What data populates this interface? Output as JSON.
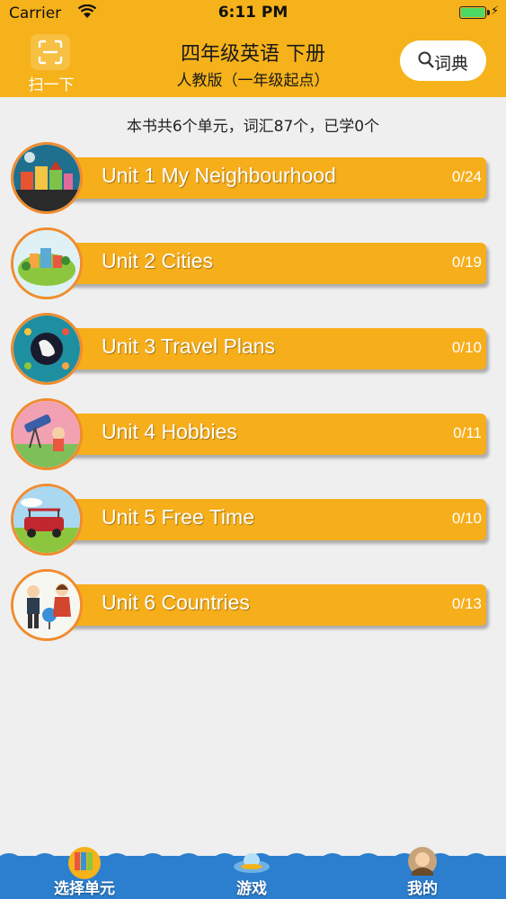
{
  "status_bar": {
    "carrier": "Carrier",
    "time": "6:11 PM",
    "wifi_icon": "wifi-icon",
    "battery_icon": "battery-icon",
    "battery_level": 1.0
  },
  "header": {
    "scan_label": "扫一下",
    "title": "四年级英语 下册",
    "subtitle": "人教版（一年级起点）",
    "dictionary_label": "词典",
    "colors": {
      "header_bg": "#f6b21a",
      "accent_border": "#f08c2e"
    }
  },
  "summary": "本书共6个单元，词汇87个，已学0个",
  "units": [
    {
      "label": "Unit 1 My Neighbourhood",
      "progress": "0/24",
      "thumb_icon": "neighbourhood-illustration"
    },
    {
      "label": "Unit 2 Cities",
      "progress": "0/19",
      "thumb_icon": "cities-illustration"
    },
    {
      "label": "Unit 3 Travel Plans",
      "progress": "0/10",
      "thumb_icon": "travel-globe-illustration"
    },
    {
      "label": "Unit 4 Hobbies",
      "progress": "0/11",
      "thumb_icon": "hobbies-telescope-illustration"
    },
    {
      "label": "Unit 5 Free Time",
      "progress": "0/10",
      "thumb_icon": "free-time-car-illustration"
    },
    {
      "label": "Unit 6 Countries",
      "progress": "0/13",
      "thumb_icon": "countries-globe-illustration"
    }
  ],
  "tab_bar": {
    "tabs": [
      {
        "label": "选择单元",
        "icon": "books-icon"
      },
      {
        "label": "游戏",
        "icon": "ufo-icon"
      },
      {
        "label": "我的",
        "icon": "profile-avatar-icon"
      }
    ],
    "color": "#2c7fcf"
  }
}
